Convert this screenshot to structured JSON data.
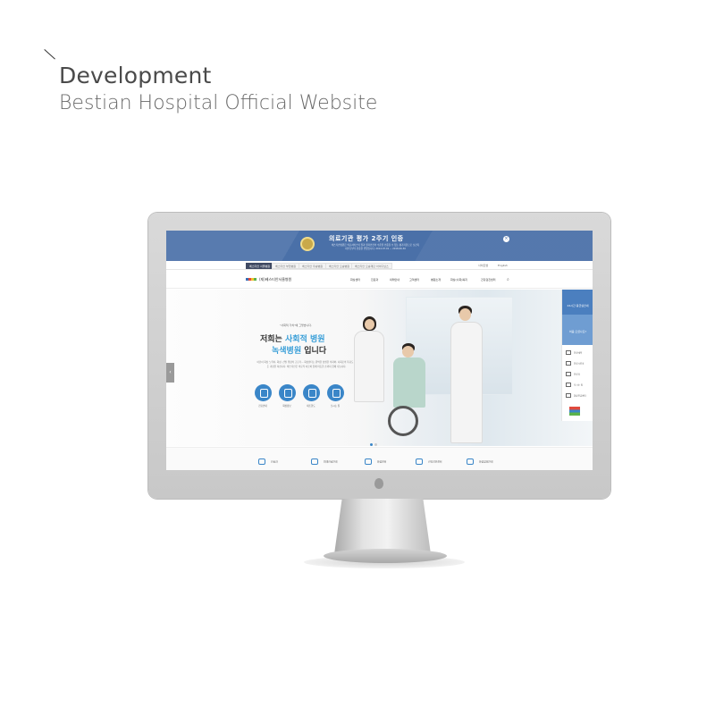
{
  "heading": {
    "title": "Development",
    "subtitle": "Bestian Hospital Official Website"
  },
  "website": {
    "banner": {
      "title": "의료기관 평가 2주기 인증",
      "text": "베스티안병원은 의료서비스의 질과 환자안전의 수준을 인증할 수 있는 평가기준으로 보건복지부로부터 인증을 받았습니다. 2014.07.01 ~ 2018.06.30",
      "close_icon": "close-icon"
    },
    "topbar": {
      "tabs": [
        "베스티안 서울병원",
        "베스티안 부천병원",
        "베스티안 우송병원",
        "베스티안 오송병원",
        "베스티안 오송재단 아이디닝스"
      ],
      "right": [
        "사이트맵",
        "English"
      ]
    },
    "nav": {
      "logo": "(재)베스티안서울병원",
      "items": [
        "화상센터",
        "진료과",
        "외래안내",
        "고객센터",
        "병원소개",
        "화상(사회)복지",
        "건강검진센터"
      ],
      "search_icon": "search-icon"
    },
    "hero": {
      "quote": "\"사회적 가치\"에 그렇습니다.",
      "line1_a": "저희는 ",
      "line1_hl": "사회적 병원",
      "line2_hl": "녹색병원",
      "line2_b": " 입니다",
      "desc": "어린이 화상 노력이, 화상, 신발 행정의 고로가... 화상센터는 완벽한 성실한 의지와, 사회로의 복귀도 힘든 과정을 하십니다. 베스티안은 의료적 이로와 함께 따듯한 손까지 함께 나눕니다.",
      "buttons": [
        "진료안내",
        "화상정보",
        "네트한도",
        "오시는 길"
      ],
      "slide_count": 2,
      "active_slide": 1
    },
    "quick_menu": {
      "top": "24시간 응급실안내",
      "second": "처음 오셨나요?",
      "items": [
        "진료예약",
        "진료시간표",
        "진료과",
        "오시는 길",
        "화상응급센터"
      ]
    },
    "bottombar": {
      "items": [
        "진료과",
        "외래진료안내",
        "화상센터",
        "건강검진센터",
        "화상정보안내"
      ]
    }
  }
}
